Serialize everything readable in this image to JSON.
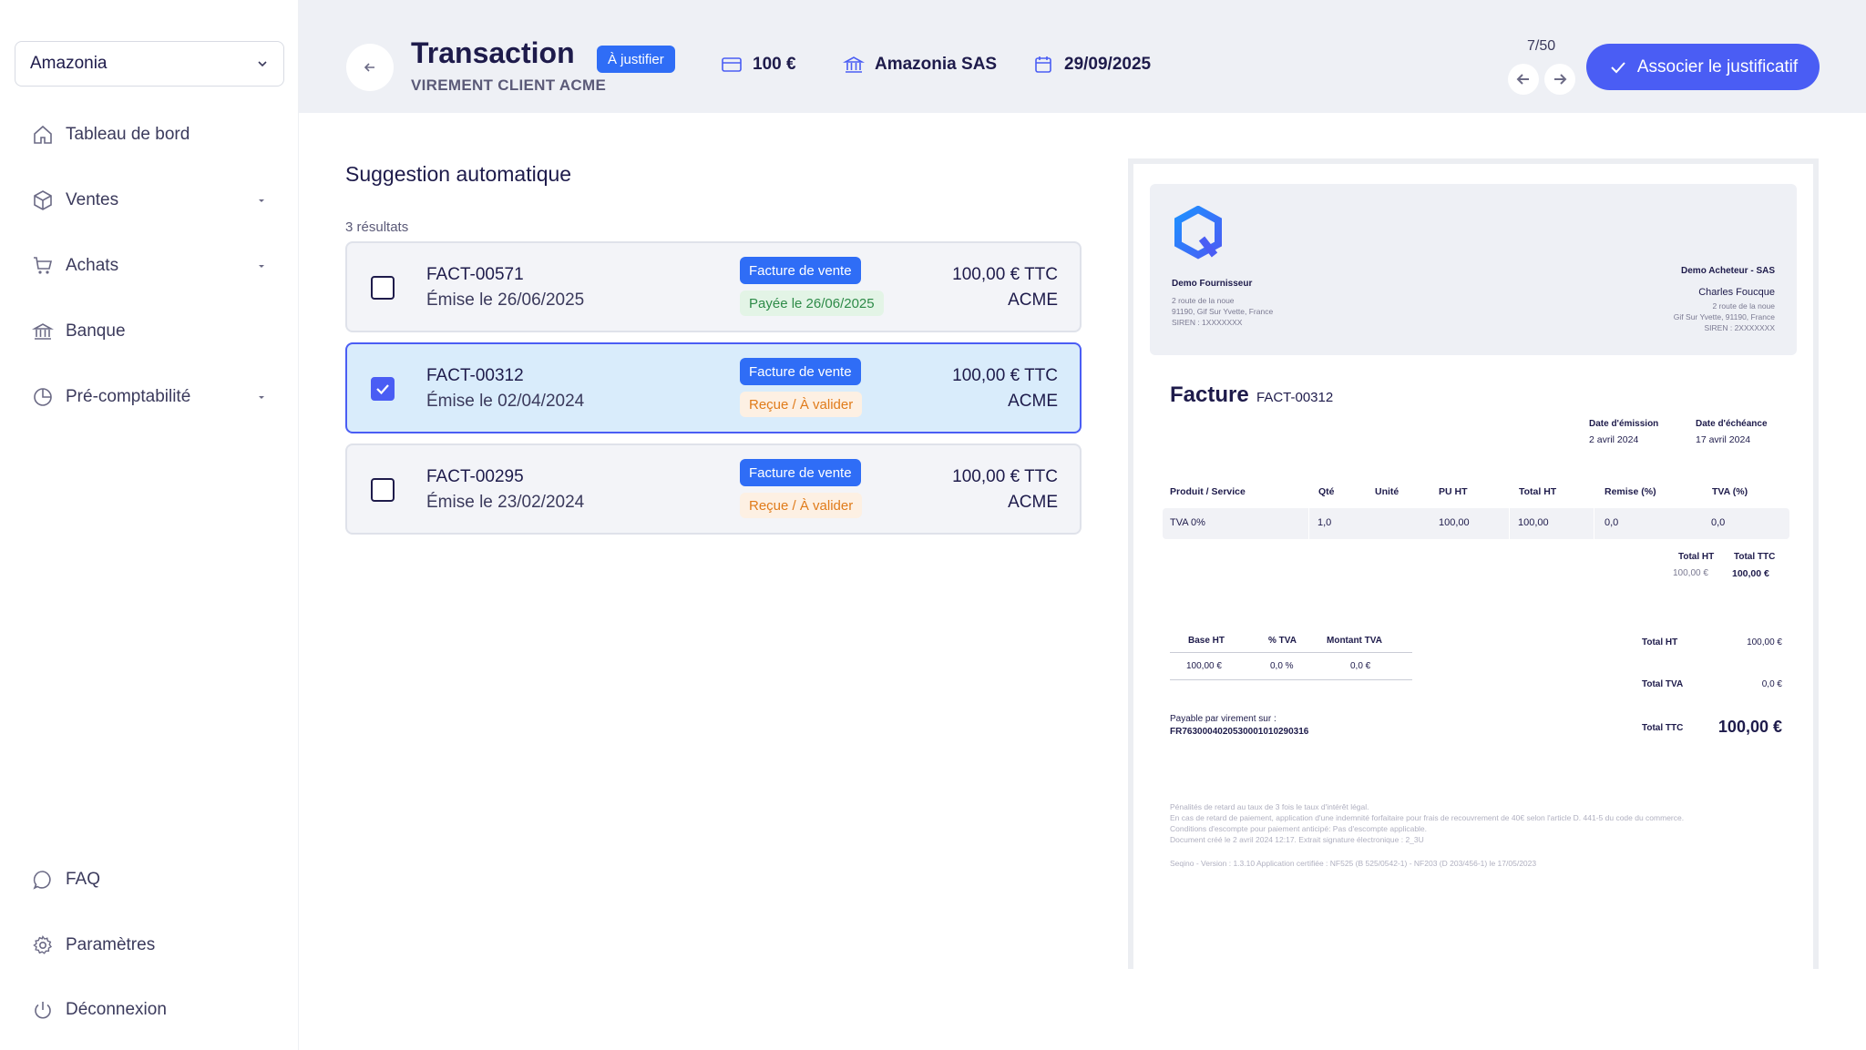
{
  "sidebar": {
    "organization": "Amazonia",
    "items": [
      {
        "label": "Tableau de bord",
        "icon": "home-icon"
      },
      {
        "label": "Ventes",
        "icon": "box-icon",
        "expandable": true
      },
      {
        "label": "Achats",
        "icon": "cart-icon",
        "expandable": true
      },
      {
        "label": "Banque",
        "icon": "bank-icon"
      },
      {
        "label": "Pré-comptabilité",
        "icon": "pie-chart-icon",
        "expandable": true
      }
    ],
    "bottom_items": [
      {
        "label": "FAQ",
        "icon": "chat-icon"
      },
      {
        "label": "Paramètres",
        "icon": "gear-icon"
      },
      {
        "label": "Déconnexion",
        "icon": "power-icon"
      }
    ]
  },
  "header": {
    "title": "Transaction",
    "subtitle": "VIREMENT CLIENT ACME",
    "status": "À justifier",
    "amount": "100 €",
    "bank": "Amazonia SAS",
    "date": "29/09/2025",
    "pager": "7/50",
    "primary_action": "Associer le justificatif"
  },
  "suggestions": {
    "title": "Suggestion automatique",
    "count": "3 résultats",
    "items": [
      {
        "ref": "FACT-00571",
        "date": "Émise le 26/06/2025",
        "type": "Facture de vente",
        "state": "Payée le 26/06/2025",
        "state_kind": "paid",
        "amount": "100,00 € TTC",
        "client": "ACME",
        "selected": false
      },
      {
        "ref": "FACT-00312",
        "date": "Émise le 02/04/2024",
        "type": "Facture de vente",
        "state": "Reçue / À valider",
        "state_kind": "wait",
        "amount": "100,00 € TTC",
        "client": "ACME",
        "selected": true
      },
      {
        "ref": "FACT-00295",
        "date": "Émise le 23/02/2024",
        "type": "Facture de vente",
        "state": "Reçue / À valider",
        "state_kind": "wait",
        "amount": "100,00 € TTC",
        "client": "ACME",
        "selected": false
      }
    ]
  },
  "invoice": {
    "supplier_name": "Demo Fournisseur",
    "supplier_addr1": "2 route de la noue",
    "supplier_addr2": "91190, Gif Sur Yvette, France",
    "supplier_siren": "SIREN : 1XXXXXXX",
    "buyer_name": "Demo Acheteur - SAS",
    "buyer_contact": "Charles Foucque",
    "buyer_addr1": "2 route de la noue",
    "buyer_addr2": "Gif Sur Yvette, 91190, France",
    "buyer_siren": "SIREN : 2XXXXXXX",
    "title": "Facture",
    "ref": "FACT-00312",
    "issue_label": "Date d'émission",
    "issue_date": "2 avril 2024",
    "due_label": "Date d'échéance",
    "due_date": "17 avril 2024",
    "columns": [
      "Produit / Service",
      "Qté",
      "Unité",
      "PU HT",
      "Total HT",
      "Remise (%)",
      "TVA (%)"
    ],
    "row": [
      "TVA 0%",
      "1,0",
      "",
      "100,00",
      "100,00",
      "0,0",
      "0,0"
    ],
    "sub_total_ht_label": "Total HT",
    "sub_total_ht": "100,00 €",
    "sub_total_ttc_label": "Total TTC",
    "sub_total_ttc": "100,00 €",
    "vat_columns": [
      "Base HT",
      "% TVA",
      "Montant TVA"
    ],
    "vat_row": [
      "100,00 €",
      "0,0 %",
      "0,0 €"
    ],
    "total_ht_label": "Total HT",
    "total_ht": "100,00 €",
    "total_tva_label": "Total TVA",
    "total_tva": "0,0 €",
    "total_ttc_label": "Total TTC",
    "total_ttc": "100,00 €",
    "payment_label": "Payable par virement sur :",
    "iban": "FR7630004020530001010290316",
    "note1": "Pénalités de retard au taux de 3 fois le taux d'intérêt légal.",
    "note2": "En cas de retard de paiement, application d'une indemnité forfaitaire pour frais de recouvrement de 40€ selon l'article D. 441-5 du code du commerce.",
    "note3": "Conditions d'escompte pour paiement anticipé: Pas d'escompte applicable.",
    "note4": "Document créé le 2 avril 2024 12:17. Extrait signature électronique : 2_3U",
    "note5": "Seqino - Version : 1.3.10 Application certifiée : NF525 (B 525/0542-1) - NF203 (D 203/456-1) le 17/05/2023"
  },
  "colors": {
    "accent": "#4a5df4",
    "badge_blue": "#2f6df6",
    "header_bg": "#eef0f5",
    "selected_bg": "#d9ecfb"
  }
}
